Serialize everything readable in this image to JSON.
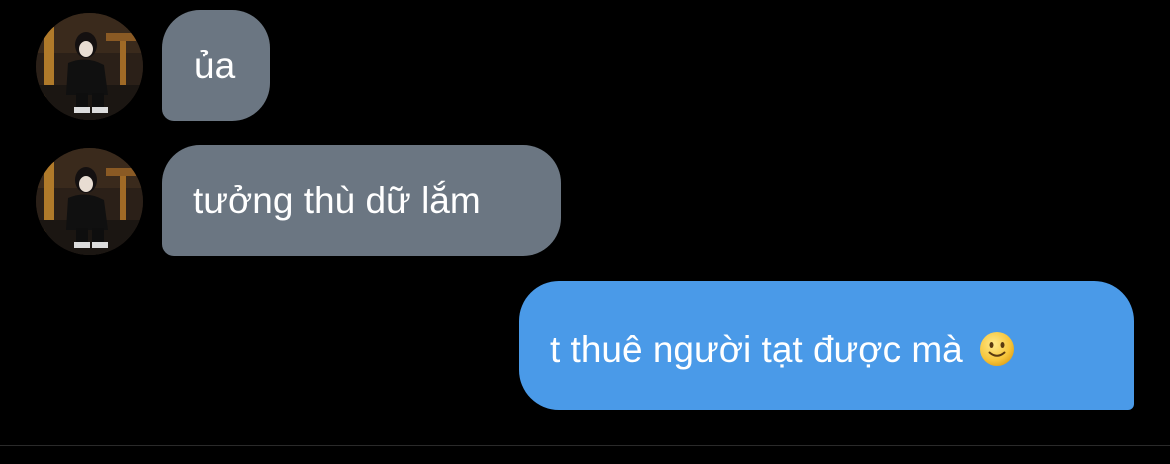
{
  "conversation": {
    "messages": [
      {
        "direction": "incoming",
        "text": "ủa"
      },
      {
        "direction": "incoming",
        "text": "tưởng thù dữ lắm"
      },
      {
        "direction": "outgoing",
        "text": "t thuê người tạt được mà",
        "emoji": "slightly-smiling-face"
      }
    ]
  },
  "colors": {
    "background": "#000000",
    "incoming_bubble": "#6b7682",
    "outgoing_bubble": "#4a9ae8",
    "text": "#ffffff"
  }
}
